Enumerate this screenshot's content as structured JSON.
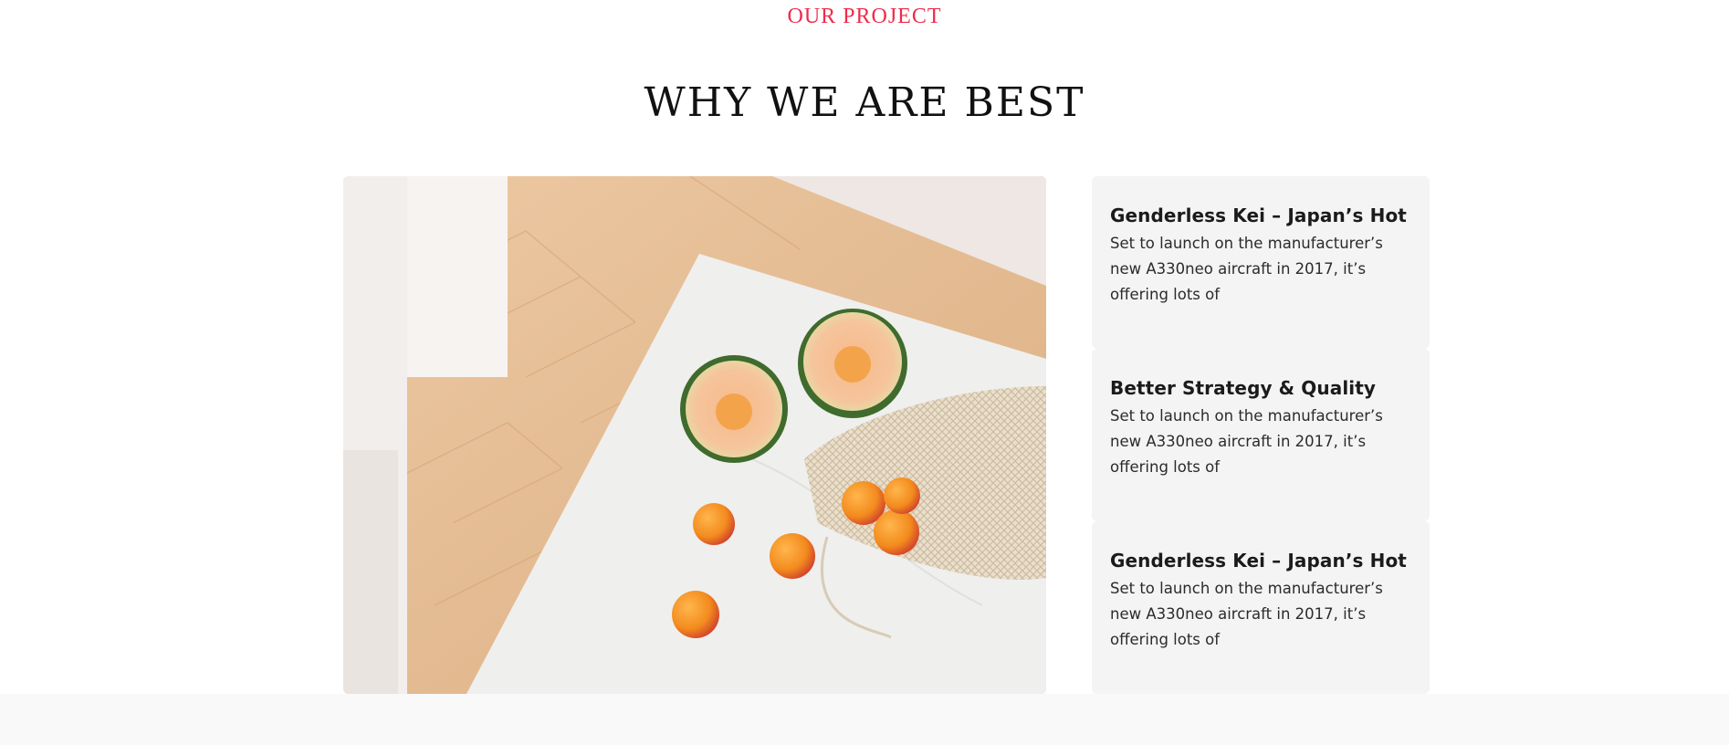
{
  "section": {
    "eyebrow": "OUR PROJECT",
    "heading": "WHY WE ARE BEST"
  },
  "image": {
    "icon": "fruit-photo",
    "colors": {
      "floor": "#e3b98f",
      "table": "#efefee",
      "melon": "#f5b07a",
      "apricot": "#f4932a"
    }
  },
  "features": [
    {
      "title": "Genderless Kei – Japan’s Hot",
      "text": "Set to launch on the manufacturer’s new A330neo aircraft in 2017, it’s offering lots of"
    },
    {
      "title": "Better Strategy & Quality",
      "text": "Set to launch on the manufacturer’s new A330neo aircraft in 2017, it’s offering lots of"
    },
    {
      "title": "Genderless Kei – Japan’s Hot",
      "text": "Set to launch on the manufacturer’s new A330neo aircraft in 2017, it’s offering lots of"
    }
  ],
  "colors": {
    "accent": "#ef2b4b",
    "card_bg": "#f4f4f4",
    "footer_bg": "#f9f9f9"
  }
}
